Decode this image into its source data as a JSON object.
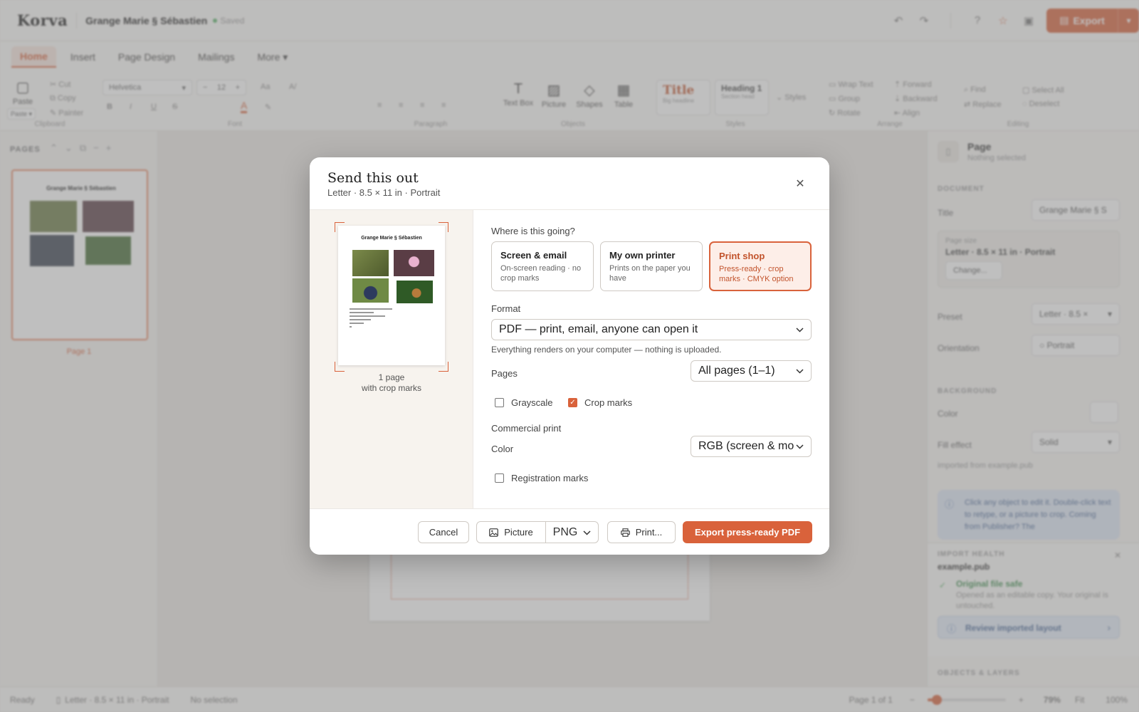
{
  "app": {
    "logo": "Korva",
    "doc_title": "Grange Marie § Sébastien",
    "saved": "Saved",
    "export_label": "Export"
  },
  "tabs": [
    {
      "label": "Home",
      "active": true
    },
    {
      "label": "Insert"
    },
    {
      "label": "Page Design"
    },
    {
      "label": "Mailings"
    },
    {
      "label": "More"
    }
  ],
  "ribbon": {
    "clipboard": {
      "paste": "Paste",
      "cut": "Cut",
      "copy": "Copy",
      "painter": "Painter",
      "paste_menu": "Paste ▾",
      "label": "Clipboard"
    },
    "font": {
      "family": "Helvetica",
      "size": "12",
      "label": "Font",
      "case": "Aa",
      "clear": "A/"
    },
    "paragraph": {
      "label": "Paragraph"
    },
    "objects": {
      "text_box": "Text Box",
      "picture": "Picture",
      "shapes": "Shapes",
      "table": "Table",
      "label": "Objects"
    },
    "styles": {
      "title_name": "Title",
      "title_sub": "Big headline",
      "heading_name": "Heading 1",
      "heading_sub": "Section head",
      "more": "Styles",
      "label": "Styles"
    },
    "arrange": {
      "wrap": "Wrap Text",
      "group": "Group",
      "rotate": "Rotate",
      "forward": "Forward",
      "backward": "Backward",
      "align": "Align",
      "label": "Arrange"
    },
    "editing": {
      "find": "Find",
      "replace": "Replace",
      "select_all": "Select All",
      "deselect": "Deselect",
      "label": "Editing"
    }
  },
  "pages_panel": {
    "header": "PAGES",
    "page_label": "Page 1"
  },
  "inspector": {
    "title": "Page",
    "subtitle": "Nothing selected",
    "document_header": "DOCUMENT",
    "title_label": "Title",
    "title_value": "Grange Marie § S",
    "page_size_label": "Page size",
    "page_size_value": "Letter · 8.5 × 11 in · Portrait",
    "change": "Change...",
    "preset_label": "Preset",
    "preset_value": "Letter · 8.5 ×",
    "orientation_label": "Orientation",
    "orientation_value": "Portrait",
    "background_header": "BACKGROUND",
    "color_label": "Color",
    "fill_label": "Fill effect",
    "fill_value": "Solid",
    "imported_note": "imported from example.pub",
    "tip": "Click any object to edit it. Double-click text to retype, or a picture to crop. Coming from Publisher? The",
    "import_health": "IMPORT HEALTH",
    "import_file": "example.pub",
    "safe_title": "Original file safe",
    "safe_desc": "Opened as an editable copy. Your original is untouched.",
    "review": "Review imported layout",
    "layers": "OBJECTS & LAYERS"
  },
  "statusbar": {
    "ready": "Ready",
    "size": "Letter · 8.5 × 11 in · Portrait",
    "selection": "No selection",
    "page": "Page 1 of 1",
    "zoom": "79%",
    "fit": "Fit",
    "hundred": "100%",
    "zoom_fraction": 0.12
  },
  "modal": {
    "title": "Send this out",
    "subtitle": "Letter · 8.5 × 11 in · Portrait",
    "preview": {
      "doc_title": "Grange Marie § Sébastien",
      "caption_line1": "1 page",
      "caption_line2": "with crop marks"
    },
    "destination_label": "Where is this going?",
    "destinations": [
      {
        "title": "Screen & email",
        "desc": "On-screen reading · no crop marks",
        "selected": false
      },
      {
        "title": "My own printer",
        "desc": "Prints on the paper you have",
        "selected": false
      },
      {
        "title": "Print shop",
        "desc": "Press-ready · crop marks · CMYK option",
        "selected": true
      }
    ],
    "format_label": "Format",
    "format_value": "PDF — print, email, anyone can open it",
    "format_hint": "Everything renders on your computer — nothing is uploaded.",
    "pages_label": "Pages",
    "pages_value": "All pages (1–1)",
    "grayscale_label": "Grayscale",
    "grayscale_checked": false,
    "crop_label": "Crop marks",
    "crop_checked": true,
    "commercial_label": "Commercial print",
    "color_label": "Color",
    "color_value": "RGB (screen & mo",
    "registration_label": "Registration marks",
    "registration_checked": false,
    "cancel": "Cancel",
    "picture": "Picture",
    "picture_format": "PNG",
    "print": "Print...",
    "export": "Export press-ready PDF"
  },
  "colors": {
    "accent": "#d9623b",
    "accent_soft": "#fdeee8",
    "backdrop": "#808080"
  }
}
